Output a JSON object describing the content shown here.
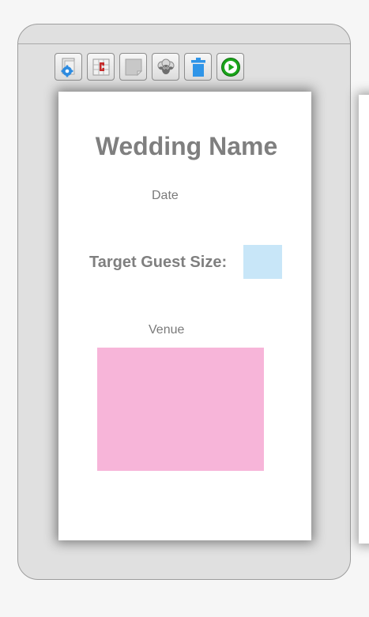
{
  "toolbar": {
    "tools": [
      {
        "icon": "document-settings-icon",
        "label": "Settings"
      },
      {
        "icon": "magnet-grid-icon",
        "label": "Snap to grid"
      },
      {
        "icon": "note-icon",
        "label": "Note"
      },
      {
        "icon": "sheep-icon",
        "label": "Sheep"
      },
      {
        "icon": "trash-icon",
        "label": "Delete"
      },
      {
        "icon": "play-icon",
        "label": "Run"
      }
    ]
  },
  "card": {
    "title": "Wedding Name",
    "date_label": "Date",
    "guest_label": "Target Guest Size:",
    "guest_value": "",
    "venue_label": "Venue"
  },
  "colors": {
    "panel": "#e0e0e0",
    "title_text": "#7f7f7f",
    "guest_input_fill": "#c8e6f8",
    "venue_fill": "#f7b5d9",
    "play_green": "#1aa51a",
    "trash_blue": "#2f95e8",
    "gear_blue": "#2d8be0"
  }
}
